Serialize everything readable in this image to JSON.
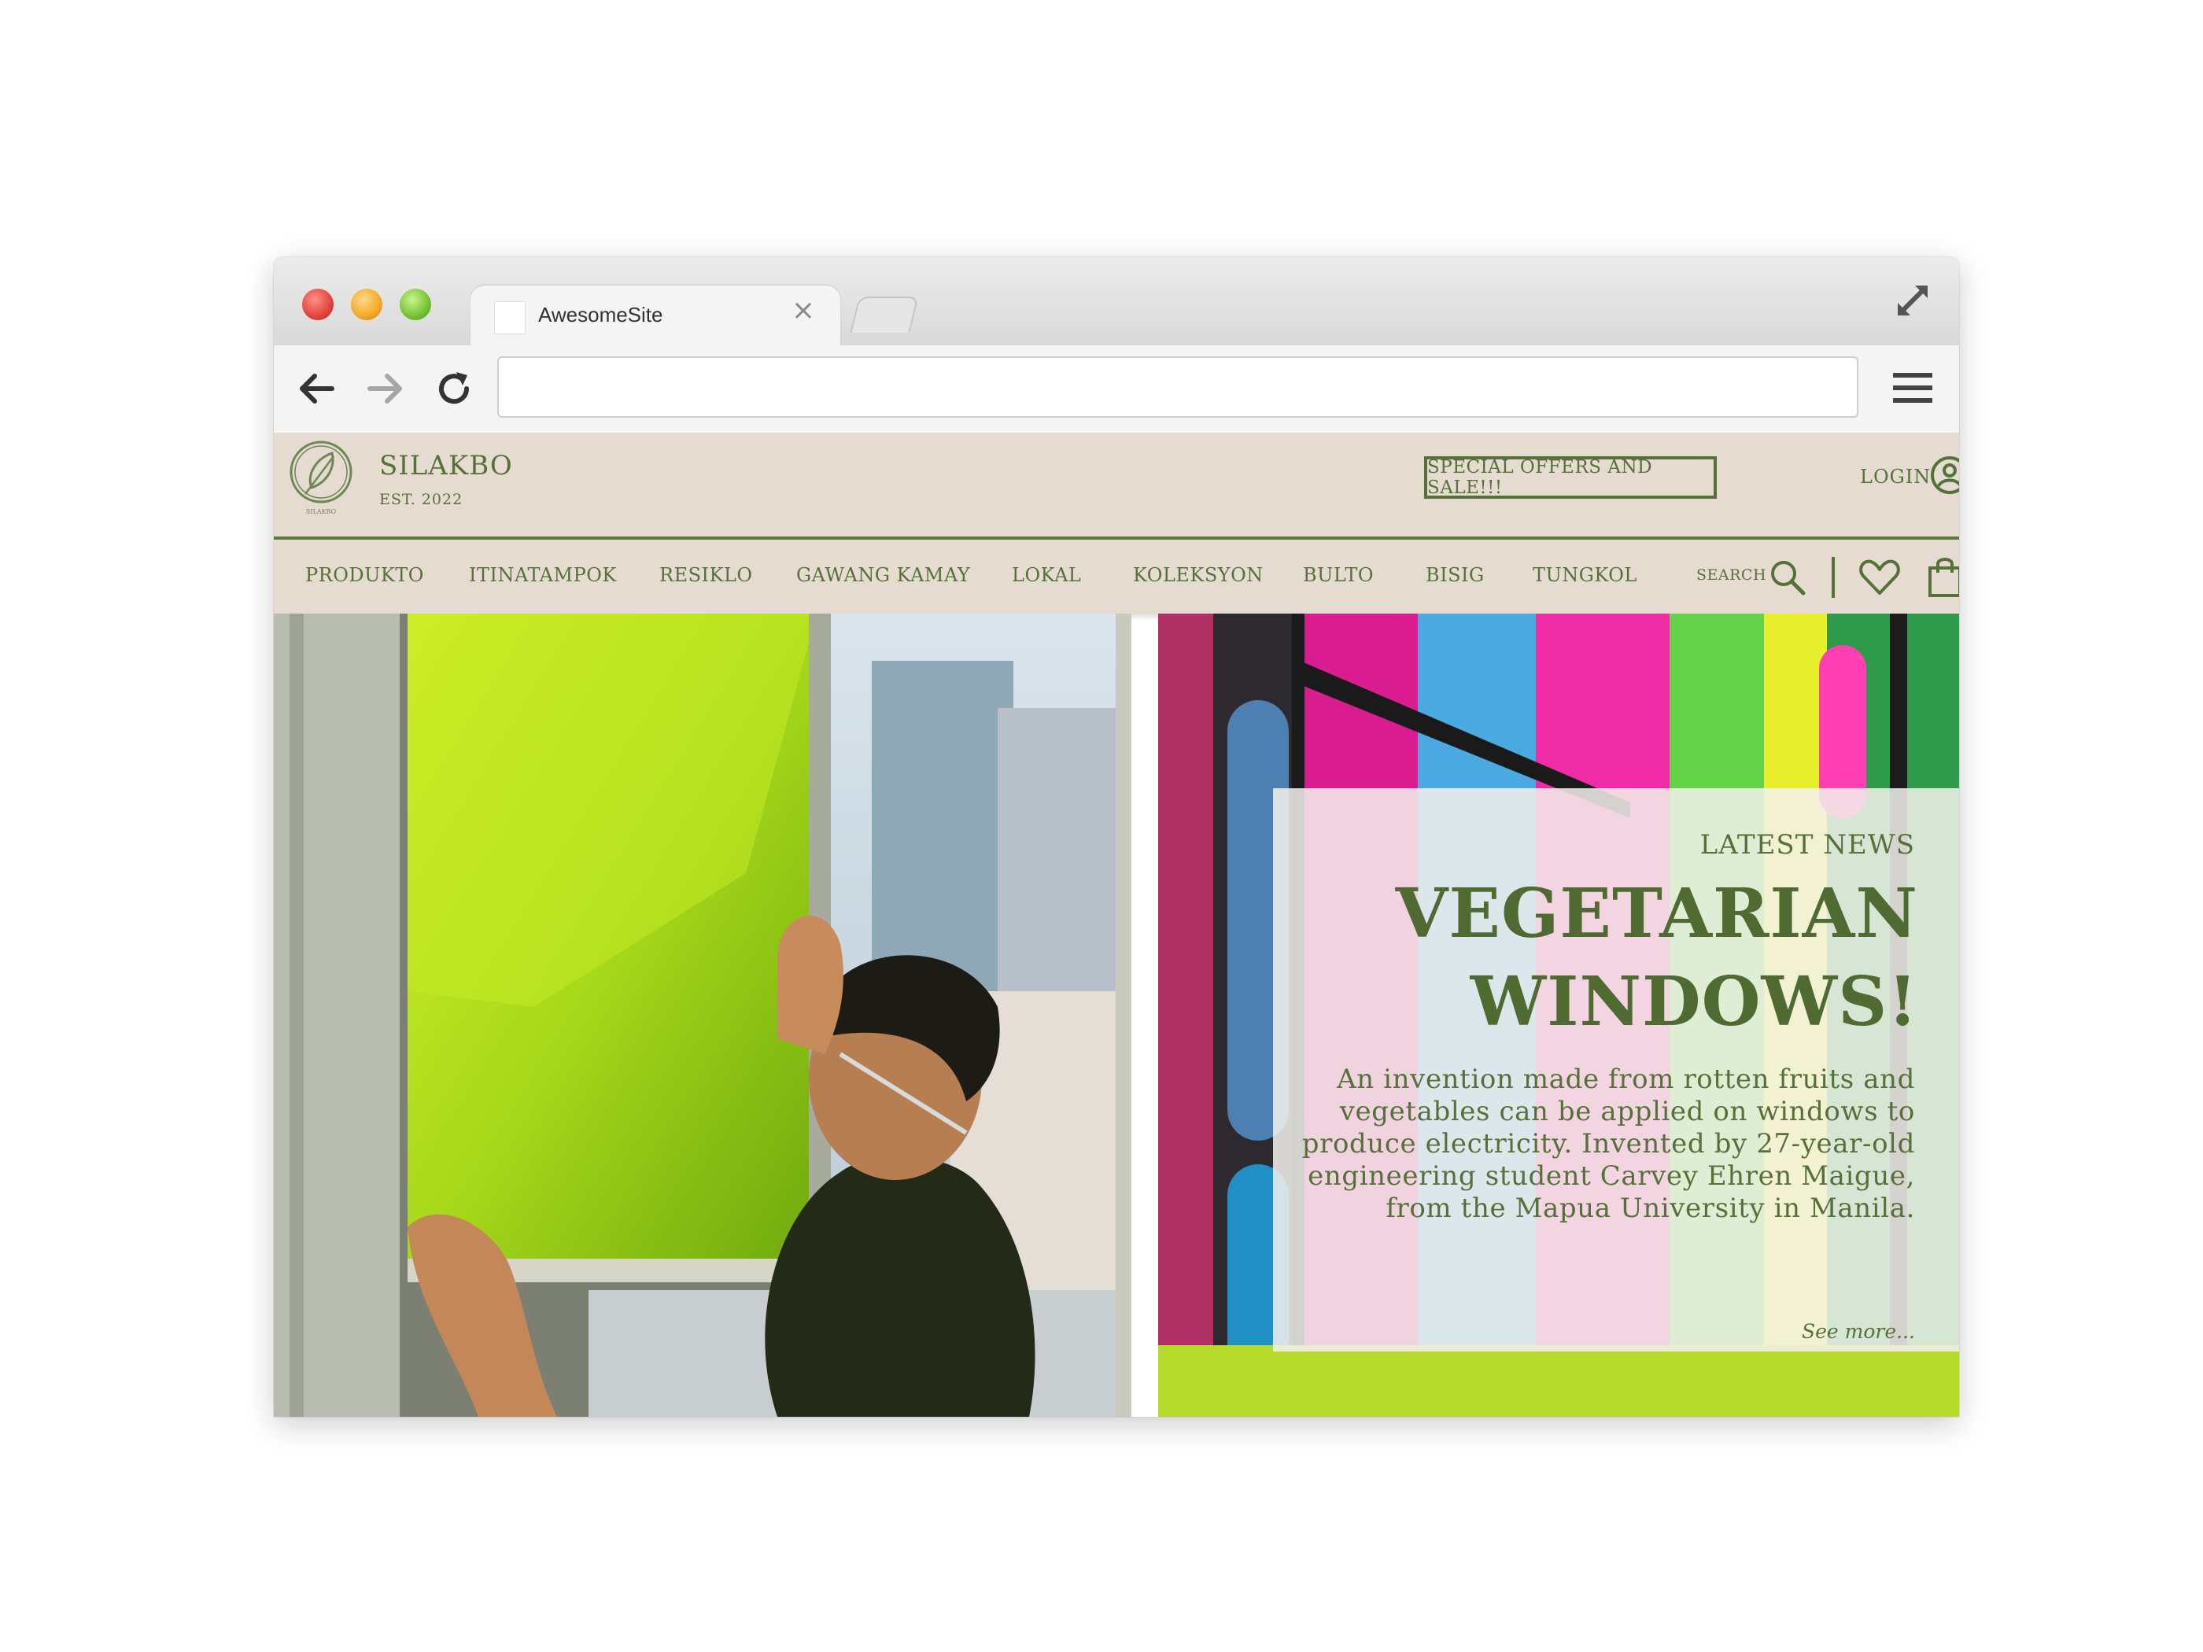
{
  "browser": {
    "tab_title": "AwesomeSite",
    "tab_close": "×",
    "url": ""
  },
  "site": {
    "brand": "SILAKBO",
    "established": "EST. 2022",
    "logo_small_text": "SILAKBO",
    "offers_button": "SPECIAL OFFERS AND SALE!!!",
    "login": "LOGIN",
    "accent_color": "#56703a",
    "header_bg": "#e5dbd1"
  },
  "nav": {
    "items": [
      "PRODUKTO",
      "ITINATAMPOK",
      "RESIKLO",
      "GAWANG KAMAY",
      "LOKAL",
      "KOLEKSYON",
      "BULTO",
      "BISIG",
      "TUNGKOL"
    ],
    "search_label": "SEARCH"
  },
  "news": {
    "label": "LATEST NEWS",
    "title_line1": "VEGETARIAN",
    "title_line2": "WINDOWS!",
    "body": "An invention made from rotten fruits and vegetables can be applied on windows to produce electricity. Invented by 27-year-old engineering student Carvey Ehren Maigue, from the Mapua University in Manila.",
    "see_more": "See more..."
  }
}
